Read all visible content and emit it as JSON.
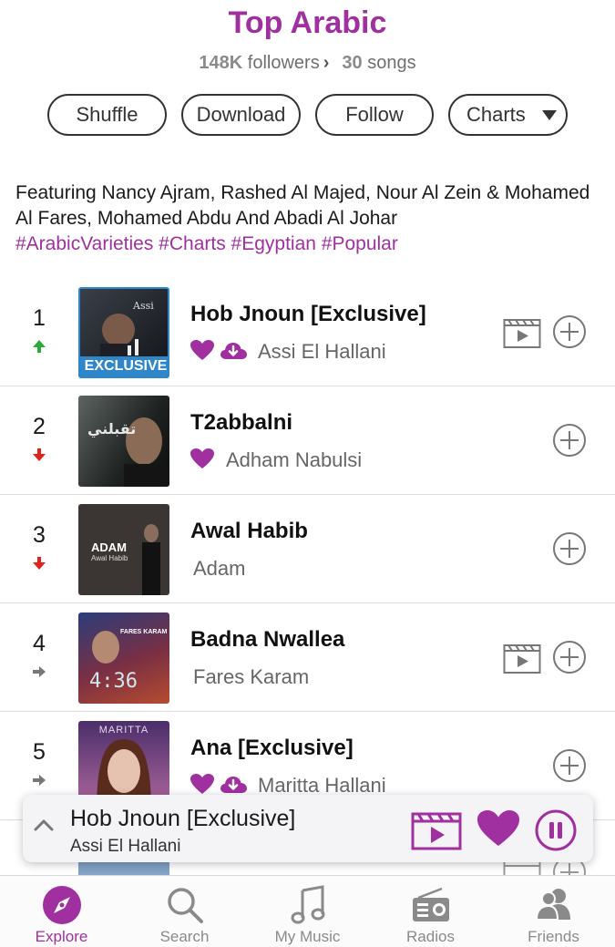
{
  "header": {
    "title": "Top Arabic",
    "followers_count": "148K",
    "followers_label": "followers",
    "songs_count": "30",
    "songs_label": "songs"
  },
  "actions": {
    "shuffle": "Shuffle",
    "download": "Download",
    "follow": "Follow",
    "charts": "Charts"
  },
  "description": {
    "text": "Featuring Nancy Ajram, Rashed Al Majed, Nour Al Zein & Mohamed Al Fares, Mohamed Abdu And Abadi Al Johar",
    "tags": "#ArabicVarieties #Charts #Egyptian #Popular"
  },
  "songs": [
    {
      "rank": "1",
      "title": "Hob Jnoun [Exclusive]",
      "artist": "Assi El Hallani",
      "trend": "up",
      "badge": "EXCLUSIVE",
      "liked": true,
      "downloaded": true,
      "has_video": true
    },
    {
      "rank": "2",
      "title": "T2abbalni",
      "artist": "Adham Nabulsi",
      "trend": "down",
      "liked": true,
      "downloaded": false,
      "has_video": false
    },
    {
      "rank": "3",
      "title": "Awal Habib",
      "artist": "Adam",
      "trend": "down",
      "liked": false,
      "downloaded": false,
      "has_video": false,
      "art_text": "ADAM",
      "art_subtext": "Awal Habib"
    },
    {
      "rank": "4",
      "title": "Badna Nwallea",
      "artist": "Fares Karam",
      "trend": "same",
      "liked": false,
      "downloaded": false,
      "has_video": true,
      "art_text": "FARES KARAM"
    },
    {
      "rank": "5",
      "title": "Ana [Exclusive]",
      "artist": "Maritta Hallani",
      "trend": "same",
      "liked": true,
      "downloaded": true,
      "has_video": false,
      "art_text": "MARITTA"
    }
  ],
  "player": {
    "title": "Hob Jnoun [Exclusive]",
    "artist": "Assi El Hallani"
  },
  "tabs": [
    {
      "label": "Explore",
      "icon": "compass-icon",
      "active": true
    },
    {
      "label": "Search",
      "icon": "search-icon",
      "active": false
    },
    {
      "label": "My Music",
      "icon": "music-note-icon",
      "active": false
    },
    {
      "label": "Radios",
      "icon": "radio-icon",
      "active": false
    },
    {
      "label": "Friends",
      "icon": "friends-icon",
      "active": false
    }
  ],
  "colors": {
    "accent": "#a0309f",
    "trend_up": "#2eaa3a",
    "trend_down": "#e0231b",
    "trend_same": "#777777",
    "exclusive_badge": "#2f86c8"
  }
}
